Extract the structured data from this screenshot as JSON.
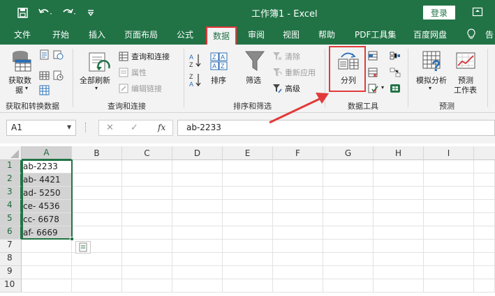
{
  "title_bar": {
    "document_title": "工作簿1  -  Excel",
    "login_label": "登录"
  },
  "tabs": [
    {
      "label": "文件"
    },
    {
      "label": "开始"
    },
    {
      "label": "插入"
    },
    {
      "label": "页面布局"
    },
    {
      "label": "公式"
    },
    {
      "label": "数据"
    },
    {
      "label": "审阅"
    },
    {
      "label": "视图"
    },
    {
      "label": "帮助"
    },
    {
      "label": "PDF工具集"
    },
    {
      "label": "百度网盘"
    },
    {
      "label": "告"
    }
  ],
  "ribbon": {
    "get_data_line1": "获取数",
    "get_data_line2": "据",
    "group_get_transform": "获取和转换数据",
    "refresh_all": "全部刷新",
    "queries_connections": "查询和连接",
    "properties": "属性",
    "edit_links": "编辑链接",
    "group_queries": "查询和连接",
    "sort": "排序",
    "filter": "筛选",
    "clear": "清除",
    "reapply": "重新应用",
    "advanced": "高级",
    "group_sort_filter": "排序和筛选",
    "text_to_columns": "分列",
    "group_data_tools": "数据工具",
    "what_if_line1": "模拟分析",
    "forecast_line1": "预测",
    "forecast_line2": "工作表",
    "group_forecast": "预测",
    "sort_az": "A↓Z",
    "sort_za": "Z↓A"
  },
  "formula_bar": {
    "name_box": "A1",
    "cancel": "✕",
    "enter": "✓",
    "fx": "fx",
    "formula": "ab-2233"
  },
  "sheet": {
    "columns": [
      "A",
      "B",
      "C",
      "D",
      "E",
      "F",
      "G",
      "H",
      "I"
    ],
    "rows": [
      "1",
      "2",
      "3",
      "4",
      "5",
      "6",
      "7",
      "8",
      "9",
      "10"
    ],
    "column_a_values": [
      "ab-2233",
      "ab- 4421",
      "ad- 5250",
      "ce- 4536",
      "cc- 6678",
      "af- 6669"
    ]
  },
  "colors": {
    "excel_green": "#217346",
    "highlight_red": "#e23a3a",
    "selection_gray": "#d3d3d3"
  }
}
